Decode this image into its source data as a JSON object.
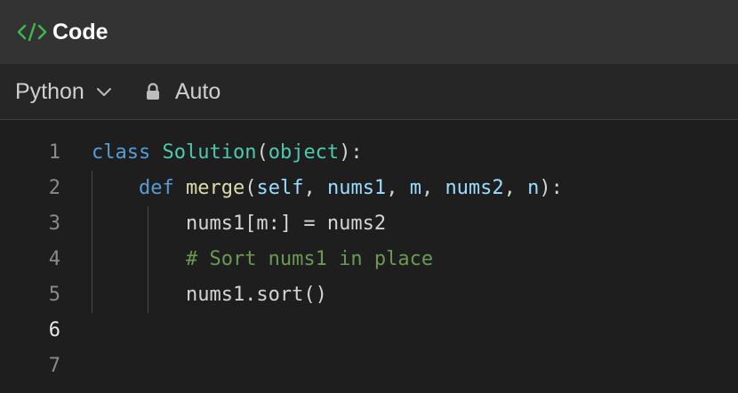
{
  "header": {
    "title": "Code",
    "icon": "code-brackets-icon",
    "accent": "#3fb950"
  },
  "toolbar": {
    "language": "Python",
    "mode_label": "Auto"
  },
  "editor": {
    "active_line": 6,
    "line_numbers": [
      "1",
      "2",
      "3",
      "4",
      "5",
      "6",
      "7"
    ],
    "lines": [
      {
        "tokens": [
          {
            "t": "class",
            "k": "kw"
          },
          {
            "t": " ",
            "k": "plain"
          },
          {
            "t": "Solution",
            "k": "cls"
          },
          {
            "t": "(",
            "k": "plain"
          },
          {
            "t": "object",
            "k": "cls"
          },
          {
            "t": "):",
            "k": "plain"
          }
        ]
      },
      {
        "tokens": [
          {
            "t": "    ",
            "k": "plain"
          },
          {
            "t": "def",
            "k": "kw"
          },
          {
            "t": " ",
            "k": "plain"
          },
          {
            "t": "merge",
            "k": "fn"
          },
          {
            "t": "(",
            "k": "plain"
          },
          {
            "t": "self",
            "k": "param"
          },
          {
            "t": ", ",
            "k": "plain"
          },
          {
            "t": "nums1",
            "k": "param"
          },
          {
            "t": ", ",
            "k": "plain"
          },
          {
            "t": "m",
            "k": "param"
          },
          {
            "t": ", ",
            "k": "plain"
          },
          {
            "t": "nums2",
            "k": "param"
          },
          {
            "t": ", ",
            "k": "plain"
          },
          {
            "t": "n",
            "k": "param"
          },
          {
            "t": "):",
            "k": "plain"
          }
        ]
      },
      {
        "tokens": [
          {
            "t": "        nums1[m:] = nums2",
            "k": "plain"
          }
        ]
      },
      {
        "tokens": [
          {
            "t": "        ",
            "k": "plain"
          },
          {
            "t": "# Sort nums1 in place",
            "k": "cmt"
          }
        ]
      },
      {
        "tokens": [
          {
            "t": "        nums1.sort()",
            "k": "plain"
          }
        ]
      },
      {
        "tokens": []
      },
      {
        "tokens": []
      }
    ]
  }
}
